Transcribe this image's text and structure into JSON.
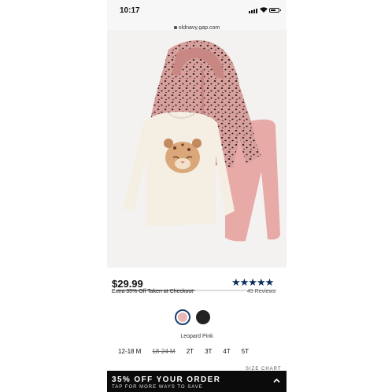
{
  "status_bar": {
    "time": "10:17"
  },
  "browser": {
    "url": "oldnavy.gap.com"
  },
  "product": {
    "price": "$29.99",
    "promo": "Extra 35% Off Taken at Checkout",
    "rating": {
      "stars": "★★★★★",
      "reviews": "45 Reviews"
    },
    "swatches": [
      "leopard-pink",
      "black-dots"
    ],
    "selected_color": "Leopard Pink",
    "sizes": [
      "12-18 M",
      "18-24 M",
      "2T",
      "3T",
      "4T",
      "5T"
    ],
    "size_chart": "SIZE CHART"
  },
  "banner": {
    "title": "35% OFF YOUR ORDER",
    "subtitle": "TAP FOR MORE WAYS TO SAVE"
  },
  "colors": {
    "star": "#0b2d5b",
    "banner_bg": "#0b0b0b",
    "hoodie": "#d9a3a0",
    "leggings": "#e7aaa6",
    "shirt": "#f5eee3"
  }
}
